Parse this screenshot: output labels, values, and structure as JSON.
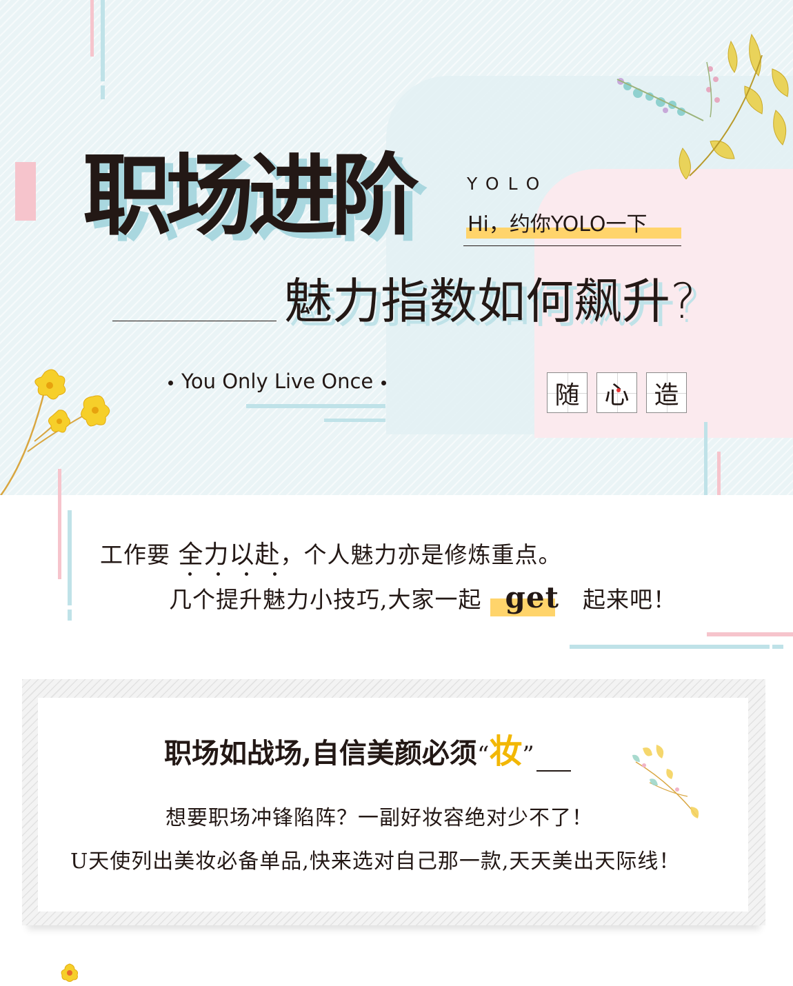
{
  "hero": {
    "title": "职场进阶",
    "yolo": "YOLO",
    "hi": "Hi，约你YOLO一下",
    "subtitle": "魅力指数如何飙升?",
    "motto": "You Only Live Once",
    "stamps": [
      "随",
      "心",
      "造"
    ]
  },
  "intro": {
    "line1_before": "工作要",
    "line1_emphasis": "全力以赴",
    "line1_after": "，个人魅力亦是修炼重点。",
    "line2_before": "几个提升魅力小技巧,大家一起",
    "line2_get": "get",
    "line2_after": "起来吧！"
  },
  "card": {
    "title_main": "职场如战场,自信美颜必须",
    "title_quote_open": "“",
    "title_highlight": "妆",
    "title_quote_close": "”",
    "line1": "想要职场冲锋陷阵？一副好妆容绝对少不了！",
    "line2": "U天使列出美妆必备单品,快来选对自己那一款,天天美出天际线！"
  },
  "colors": {
    "accent_yellow": "#ffd46b",
    "accent_blue": "#bfe2e8",
    "accent_pink": "#f6c4cc",
    "text": "#231815"
  },
  "decorations": [
    "yellow-flower-branch",
    "leaf-branch",
    "small-flower-sprig",
    "small-yellow-bloom"
  ]
}
